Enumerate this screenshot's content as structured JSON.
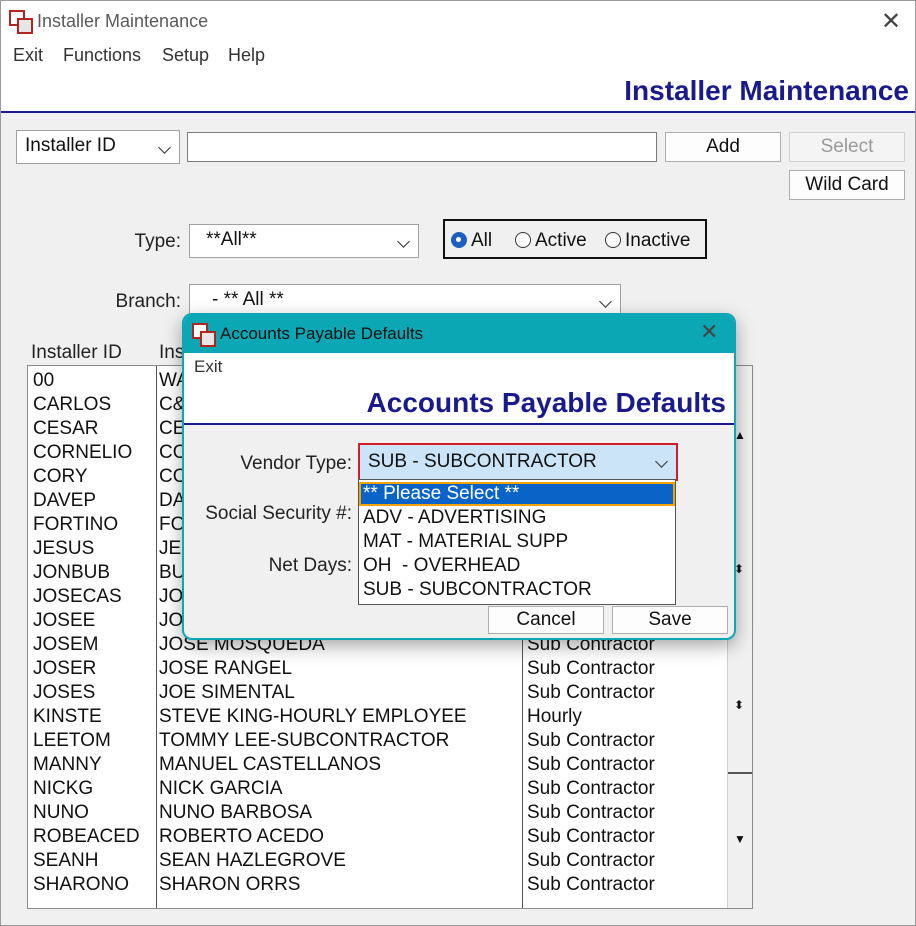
{
  "window": {
    "title": "Installer Maintenance",
    "header": "Installer Maintenance"
  },
  "menu": {
    "exit": "Exit",
    "functions": "Functions",
    "setup": "Setup",
    "help": "Help"
  },
  "search": {
    "field_select": "Installer ID",
    "query": "",
    "add": "Add",
    "select": "Select",
    "wild_card": "Wild Card"
  },
  "filters": {
    "type_label": "Type:",
    "type_value": "**All**",
    "status": {
      "all": "All",
      "active": "Active",
      "inactive": "Inactive",
      "selected": "All"
    },
    "branch_label": "Branch:",
    "branch_value": "- ** All **"
  },
  "list": {
    "columns": [
      "Installer ID",
      "Ins"
    ],
    "rows": [
      {
        "id": "00",
        "name": "WA",
        "type": ""
      },
      {
        "id": "CARLOS",
        "name": "C&",
        "type": ""
      },
      {
        "id": "CESAR",
        "name": "CE",
        "type": ""
      },
      {
        "id": "CORNELIO",
        "name": "CO",
        "type": ""
      },
      {
        "id": "CORY",
        "name": "CO",
        "type": ""
      },
      {
        "id": "DAVEP",
        "name": "DA",
        "type": ""
      },
      {
        "id": "FORTINO",
        "name": "FO",
        "type": ""
      },
      {
        "id": "JESUS",
        "name": "JE",
        "type": ""
      },
      {
        "id": "JONBUB",
        "name": "BU",
        "type": ""
      },
      {
        "id": "JOSECAS",
        "name": "JO",
        "type": ""
      },
      {
        "id": "JOSEE",
        "name": "JO",
        "type": ""
      },
      {
        "id": "JOSEM",
        "name": "JOSE MOSQUEDA",
        "type": "Sub Contractor"
      },
      {
        "id": "JOSER",
        "name": "JOSE RANGEL",
        "type": "Sub Contractor"
      },
      {
        "id": "JOSES",
        "name": "JOE SIMENTAL",
        "type": "Sub Contractor"
      },
      {
        "id": "KINSTE",
        "name": "STEVE KING-HOURLY EMPLOYEE",
        "type": "Hourly"
      },
      {
        "id": "LEETOM",
        "name": "TOMMY LEE-SUBCONTRACTOR",
        "type": "Sub Contractor"
      },
      {
        "id": "MANNY",
        "name": "MANUEL CASTELLANOS",
        "type": "Sub Contractor"
      },
      {
        "id": "NICKG",
        "name": "NICK GARCIA",
        "type": "Sub Contractor"
      },
      {
        "id": "NUNO",
        "name": "NUNO BARBOSA",
        "type": "Sub Contractor"
      },
      {
        "id": "ROBEACED",
        "name": "ROBERTO ACEDO",
        "type": "Sub Contractor"
      },
      {
        "id": "SEANH",
        "name": "SEAN HAZLEGROVE",
        "type": "Sub Contractor"
      },
      {
        "id": "SHARONO",
        "name": "SHARON ORRS",
        "type": "Sub Contractor"
      }
    ]
  },
  "dialog": {
    "title": "Accounts Payable Defaults",
    "menu_exit": "Exit",
    "header": "Accounts Payable Defaults",
    "vendor_type_label": "Vendor Type:",
    "vendor_type_value": "SUB - SUBCONTRACTOR",
    "ssn_label": "Social Security #:",
    "net_days_label": "Net Days:",
    "dropdown_options": [
      "** Please Select **",
      "ADV - ADVERTISING",
      "MAT - MATERIAL SUPP",
      "OH  - OVERHEAD",
      "SUB - SUBCONTRACTOR"
    ],
    "cancel": "Cancel",
    "save": "Save"
  },
  "colors": {
    "header_blue": "#1a1a8c",
    "dialog_teal": "#0ba7b4",
    "selection_blue": "#0a64c8",
    "focus_red": "#d21b2b",
    "focus_orange": "#f2a400"
  }
}
